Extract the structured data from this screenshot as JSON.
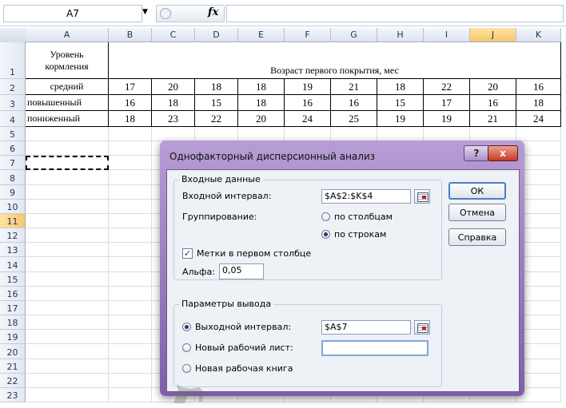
{
  "formula_bar": {
    "name_box": "A7",
    "fx": "fx",
    "formula": ""
  },
  "columns": [
    "A",
    "B",
    "C",
    "D",
    "E",
    "F",
    "G",
    "H",
    "I",
    "J",
    "K"
  ],
  "selected_column": "J",
  "rows": [
    "1",
    "2",
    "3",
    "4",
    "5",
    "6",
    "7",
    "8",
    "9",
    "10",
    "11",
    "12",
    "13",
    "14",
    "15",
    "16",
    "17",
    "18",
    "19",
    "20",
    "21",
    "22",
    "23"
  ],
  "selected_row": "11",
  "sheet": {
    "a1": "Уровень кормления",
    "header_merged": "Возраст первого покрытия, мес",
    "data": [
      {
        "label": "средний",
        "values": [
          "17",
          "20",
          "18",
          "18",
          "19",
          "21",
          "18",
          "22",
          "20",
          "16"
        ]
      },
      {
        "label": "повышенный",
        "values": [
          "16",
          "18",
          "15",
          "18",
          "16",
          "16",
          "15",
          "17",
          "16",
          "18"
        ]
      },
      {
        "label": "пониженный",
        "values": [
          "18",
          "23",
          "22",
          "20",
          "24",
          "25",
          "19",
          "19",
          "21",
          "24"
        ]
      }
    ]
  },
  "dialog": {
    "title": "Однофакторный дисперсионный анализ",
    "help": "?",
    "close": "x",
    "input_group": "Входные данные",
    "input_range_label": "Входной интервал:",
    "input_range_value": "$A$2:$K$4",
    "grouping_label": "Группирование:",
    "by_columns": "по столбцам",
    "by_rows": "по строкам",
    "labels_checkbox": "Метки в первом столбце",
    "alpha_label": "Альфа:",
    "alpha_value": "0,05",
    "output_group": "Параметры вывода",
    "output_range_label": "Выходной интервал:",
    "output_range_value": "$A$7",
    "new_sheet_label": "Новый рабочий лист:",
    "new_sheet_value": "",
    "new_book_label": "Новая рабочая книга",
    "ok": "ОК",
    "cancel": "Отмена",
    "help_button": "Справка",
    "grouping_selected": "rows",
    "output_selected": "range",
    "labels_checked": true
  }
}
